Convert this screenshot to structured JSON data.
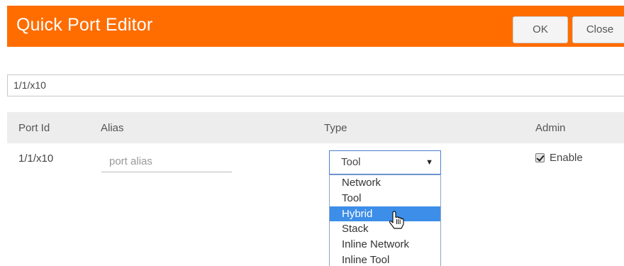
{
  "header": {
    "title": "Quick Port Editor",
    "ok_label": "OK",
    "close_label": "Close",
    "color": "#ff6d00"
  },
  "port_field": {
    "value": "1/1/x10"
  },
  "table": {
    "columns": [
      "Port Id",
      "Alias",
      "Type",
      "Admin"
    ],
    "row": {
      "port_id": "1/1/x10",
      "alias_placeholder": "port alias",
      "type_selected": "Tool",
      "admin_checked": true,
      "admin_label": "Enable"
    }
  },
  "type_dropdown": {
    "options": [
      "Network",
      "Tool",
      "Hybrid",
      "Stack",
      "Inline Network",
      "Inline Tool"
    ],
    "highlighted": "Hybrid",
    "highlight_color": "#3c8ee8",
    "arrow_icon": "caret-down-icon"
  }
}
